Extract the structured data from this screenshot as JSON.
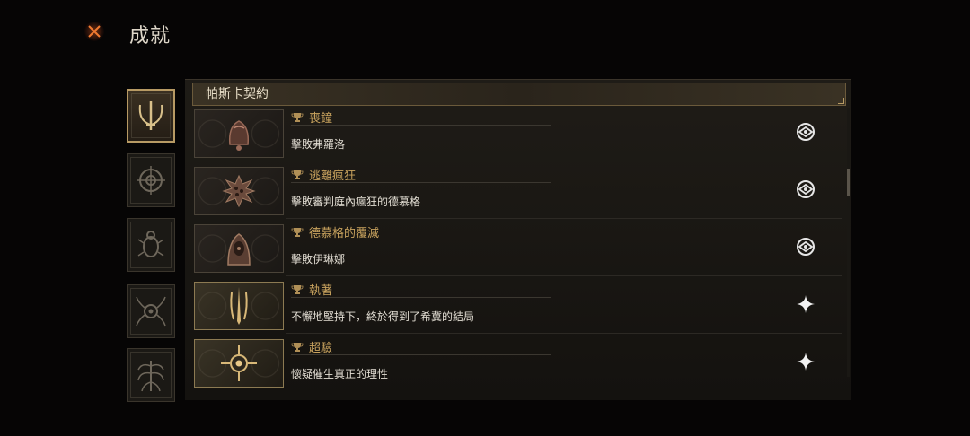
{
  "header": {
    "title": "成就",
    "close_icon": "close-x-icon"
  },
  "sidebar": {
    "categories": [
      {
        "icon": "crescent-sword-emblem-icon",
        "active": true
      },
      {
        "icon": "compass-wheel-emblem-icon",
        "active": false
      },
      {
        "icon": "scarab-emblem-icon",
        "active": false
      },
      {
        "icon": "spider-eye-emblem-icon",
        "active": false
      },
      {
        "icon": "tree-squid-emblem-icon",
        "active": false
      }
    ]
  },
  "section": {
    "title": "帕斯卡契約"
  },
  "achievements": [
    {
      "title": "喪鐘",
      "description": "擊敗弗羅洛",
      "icon": "bell-creature-icon",
      "status": "rune-emblem-icon",
      "trophy_icon": "trophy-icon"
    },
    {
      "title": "逃離瘋狂",
      "description": "擊敗審判庭內瘋狂的德慕格",
      "icon": "spiked-orb-icon",
      "status": "rune-emblem-icon",
      "trophy_icon": "trophy-icon"
    },
    {
      "title": "德慕格的覆滅",
      "description": "擊敗伊琳娜",
      "icon": "hooded-figure-icon",
      "status": "rune-emblem-icon",
      "trophy_icon": "trophy-icon"
    },
    {
      "title": "執著",
      "description": "不懈地堅持下，終於得到了希冀的結局",
      "icon": "claw-blade-icon",
      "status": "sparkle-star-icon",
      "trophy_icon": "trophy-icon"
    },
    {
      "title": "超驗",
      "description": "懷疑催生真正的理性",
      "icon": "radiant-eye-icon",
      "status": "sparkle-star-icon",
      "trophy_icon": "trophy-icon"
    }
  ],
  "colors": {
    "accent_gold": "#c9a35e",
    "active_border": "#b79a64",
    "close_orange": "#e8702a"
  }
}
